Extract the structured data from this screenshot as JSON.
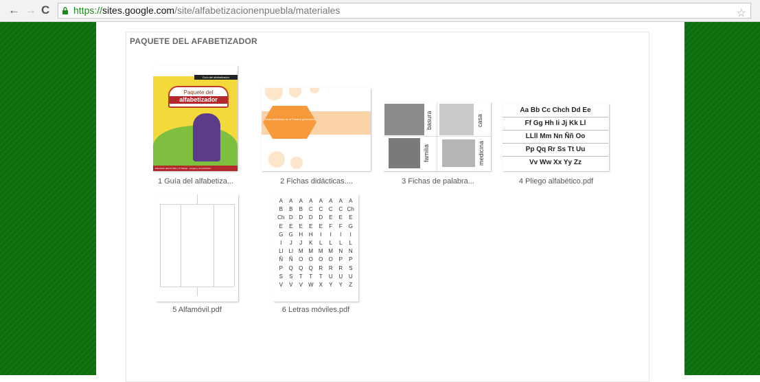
{
  "browser": {
    "url_scheme": "https://",
    "url_host": "sites.google.com",
    "url_path": "/site/alfabetizacionenpuebla/materiales",
    "back_icon": "arrow-left-icon",
    "forward_icon": "arrow-right-icon",
    "reload_icon": "reload-icon",
    "lock_icon": "lock-icon",
    "star_icon": "star-icon"
  },
  "page": {
    "section_title": "PAQUETE DEL AFABETIZADOR",
    "background_color": "#0b6e0b",
    "files": [
      {
        "caption": "1 Guía del alfabetiza...",
        "thumbnail": {
          "strip_label": "Guía del alfabetizador",
          "bubble_line1": "Paquete del",
          "bubble_line2": "alfabetizador",
          "footer": "Educación para la Vida y el Trabajo · Lengua y comunicación"
        }
      },
      {
        "caption": "2 Fichas didácticas....",
        "thumbnail": {
          "hex_text": "Fichas didácticas de la Palabra generadora"
        }
      },
      {
        "caption": "3 Fichas de palabra...",
        "thumbnail": {
          "words": [
            "basura",
            "casa",
            "familia",
            "medicina"
          ]
        }
      },
      {
        "caption": "4 Pliego alfabético.pdf",
        "thumbnail": {
          "rows": [
            "Aa Bb Cc Chch Dd Ee",
            "Ff Gg Hh Ii Jj Kk Ll",
            "LLll Mm Nn Ññ Oo",
            "Pp Qq Rr Ss Tt Uu",
            "Vv Ww Xx Yy Zz"
          ]
        }
      },
      {
        "caption": "5 Alfamóvil.pdf"
      },
      {
        "caption": "6 Letras móviles.pdf",
        "thumbnail": {
          "grid": [
            [
              "A",
              "A",
              "A",
              "A",
              "A",
              "A",
              "A",
              "A"
            ],
            [
              "B",
              "B",
              "B",
              "C",
              "C",
              "C",
              "C",
              "Ch"
            ],
            [
              "Ch",
              "D",
              "D",
              "D",
              "D",
              "E",
              "E",
              "E"
            ],
            [
              "E",
              "E",
              "E",
              "E",
              "E",
              "F",
              "F",
              "G"
            ],
            [
              "G",
              "G",
              "H",
              "H",
              "I",
              "I",
              "I",
              "I"
            ],
            [
              "I",
              "J",
              "J",
              "K",
              "L",
              "L",
              "L",
              "L"
            ],
            [
              "Ll",
              "Ll",
              "M",
              "M",
              "M",
              "M",
              "N",
              "N"
            ],
            [
              "Ñ",
              "Ñ",
              "O",
              "O",
              "O",
              "O",
              "P",
              "P"
            ],
            [
              "P",
              "Q",
              "Q",
              "Q",
              "R",
              "R",
              "R",
              "S"
            ],
            [
              "S",
              "S",
              "T",
              "T",
              "T",
              "U",
              "U",
              "U"
            ],
            [
              "V",
              "V",
              "V",
              "W",
              "X",
              "Y",
              "Y",
              "Z"
            ]
          ]
        }
      }
    ]
  }
}
